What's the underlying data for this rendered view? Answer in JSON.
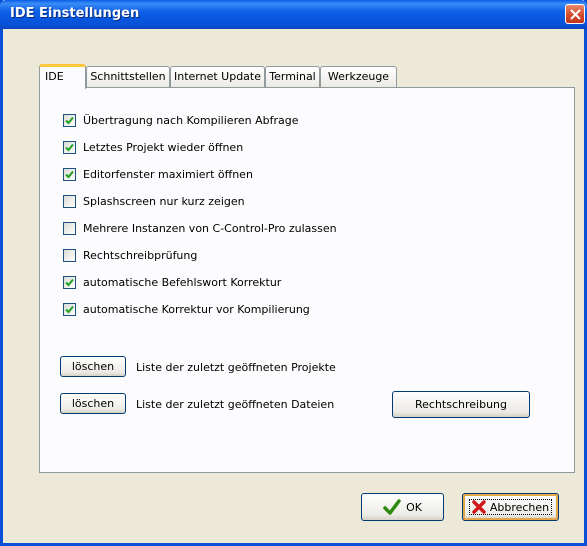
{
  "window": {
    "title": "IDE Einstellungen"
  },
  "tabs": [
    {
      "label": "IDE"
    },
    {
      "label": "Schnittstellen"
    },
    {
      "label": "Internet Update"
    },
    {
      "label": "Terminal"
    },
    {
      "label": "Werkzeuge"
    }
  ],
  "options": [
    {
      "label": "Übertragung nach Kompilieren Abfrage",
      "checked": true
    },
    {
      "label": "Letztes Projekt wieder öffnen",
      "checked": true
    },
    {
      "label": "Editorfenster maximiert öffnen",
      "checked": true
    },
    {
      "label": "Splashscreen nur kurz zeigen",
      "checked": false
    },
    {
      "label": "Mehrere Instanzen von C-Control-Pro zulassen",
      "checked": false
    },
    {
      "label": "Rechtschreibprüfung",
      "checked": false
    },
    {
      "label": "automatische Befehlswort Korrektur",
      "checked": true
    },
    {
      "label": "automatische Korrektur vor Kompilierung",
      "checked": true
    }
  ],
  "recent_projects": {
    "button": "löschen",
    "label": "Liste der zuletzt geöffneten Projekte"
  },
  "recent_files": {
    "button": "löschen",
    "label": "Liste der zuletzt geöffneten Dateien"
  },
  "spellcheck_button": "Rechtschreibung",
  "footer": {
    "ok": "OK",
    "cancel": "Abbrechen"
  }
}
